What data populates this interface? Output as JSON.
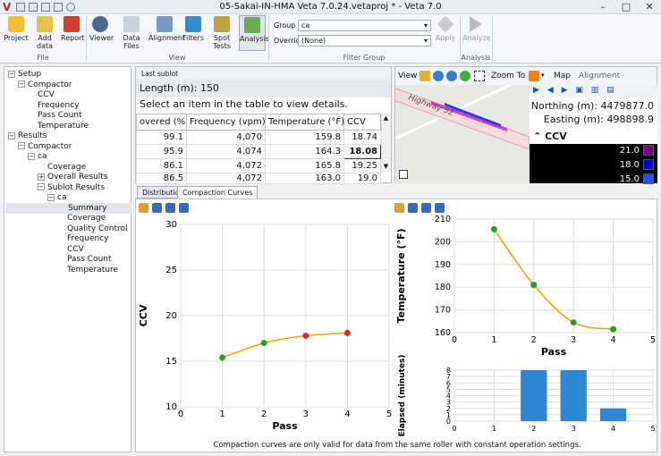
{
  "window": {
    "title": "05-Sakai-IN-HMA Veta 7.0.24.vetaproj * - Veta 7.0",
    "logo": "V"
  },
  "ribbon": {
    "file": [
      {
        "label": "Project"
      },
      {
        "label": "Add data"
      },
      {
        "label": "Report"
      }
    ],
    "file_group": "File",
    "view": [
      {
        "label": "Viewer"
      },
      {
        "label": "Data Files"
      },
      {
        "label": "Alignment"
      },
      {
        "label": "Filters"
      },
      {
        "label": "Spot Tests"
      },
      {
        "label": "Analysis"
      }
    ],
    "view_group": "View",
    "filter": {
      "group_label": "Group",
      "group_value": "ca",
      "override_label": "Override",
      "override_value": "(None)",
      "apply": "Apply"
    },
    "filter_group": "Filter Group",
    "analyze": "Analyze",
    "analysis_group": "Analysis"
  },
  "tree": [
    {
      "t": "Setup",
      "lvl": 0,
      "tg": "−"
    },
    {
      "t": "Compactor",
      "lvl": 1,
      "tg": "−"
    },
    {
      "t": "CCV",
      "lvl": 2
    },
    {
      "t": "Frequency",
      "lvl": 2
    },
    {
      "t": "Pass Count",
      "lvl": 2
    },
    {
      "t": "Temperature",
      "lvl": 2
    },
    {
      "t": "Results",
      "lvl": 0,
      "tg": "−"
    },
    {
      "t": "Compactor",
      "lvl": 1,
      "tg": "−"
    },
    {
      "t": "ca",
      "lvl": 2,
      "tg": "−"
    },
    {
      "t": "Coverage",
      "lvl": 3
    },
    {
      "t": "Overall Results",
      "lvl": 3,
      "tg": "+"
    },
    {
      "t": "Sublot Results",
      "lvl": 3,
      "tg": "−"
    },
    {
      "t": "ca",
      "lvl": 4,
      "tg": "−"
    },
    {
      "t": "Summary",
      "lvl": 5,
      "sel": true
    },
    {
      "t": "Coverage",
      "lvl": 5
    },
    {
      "t": "Quality Control",
      "lvl": 5
    },
    {
      "t": "Frequency",
      "lvl": 5
    },
    {
      "t": "CCV",
      "lvl": 5
    },
    {
      "t": "Pass Count",
      "lvl": 5
    },
    {
      "t": "Temperature",
      "lvl": 5
    }
  ],
  "sublot": {
    "header": "Last sublot",
    "length": "Length (m): 150",
    "message": "Select an item in the table to view details.",
    "columns": [
      "overed (%)",
      "Frequency (vpm)",
      "Temperature (°F)",
      "CCV"
    ],
    "rows": [
      [
        "99.1",
        "4,070",
        "159.8",
        "18.74"
      ],
      [
        "95.9",
        "4,074",
        "164.3",
        "18.08"
      ],
      [
        "86.1",
        "4,072",
        "165.8",
        "19.25"
      ],
      [
        "86.5",
        "4,072",
        "163.0",
        "19.0"
      ]
    ]
  },
  "map": {
    "view": "View",
    "zoom_to": "Zoom To",
    "map": "Map",
    "alignment": "Alignment",
    "road": "Highway 52",
    "northing": "Northing (m): 4479877.0",
    "easting": "Easting (m): 498898.9",
    "legend_title": "CCV",
    "legend": [
      {
        "v": "21.0",
        "c": "#800080"
      },
      {
        "v": "18.0",
        "c": "#0000e0"
      },
      {
        "v": "15.0",
        "c": "#2050ff"
      }
    ]
  },
  "tabs": [
    "Distribution",
    "Compaction Curves"
  ],
  "note": "Compaction curves are only valid for data from the same roller with constant operation settings.",
  "chart_data": [
    {
      "type": "line",
      "xlabel": "Pass",
      "ylabel": "CCV",
      "xlim": [
        0,
        5
      ],
      "ylim": [
        10,
        30
      ],
      "xticks": [
        "0",
        "1",
        "2",
        "3",
        "4",
        "5"
      ],
      "yticks": [
        "10",
        "15",
        "20",
        "25",
        "30"
      ],
      "x": [
        1,
        2,
        3,
        4
      ],
      "y": [
        15.4,
        17.0,
        17.8,
        18.1
      ],
      "colors": [
        "#2a9a2a",
        "#2a9a2a",
        "#e0281e",
        "#e0281e"
      ],
      "curve_color": "#f0a000"
    },
    {
      "type": "line",
      "xlabel": "Pass",
      "ylabel": "Temperature (°F)",
      "xlim": [
        0,
        5
      ],
      "ylim": [
        160,
        210
      ],
      "xticks": [
        "0",
        "1",
        "2",
        "3",
        "4",
        "5"
      ],
      "yticks": [
        "160",
        "170",
        "180",
        "190",
        "200",
        "210"
      ],
      "x": [
        1,
        2,
        3,
        4
      ],
      "y": [
        205.5,
        181,
        164.5,
        161.5
      ],
      "colors": [
        "#2a9a2a",
        "#2a9a2a",
        "#2a9a2a",
        "#2a9a2a"
      ],
      "curve_color": "#f0a000"
    },
    {
      "type": "bar",
      "xlabel": "",
      "ylabel": "Elapsed (minutes)",
      "xlim": [
        0,
        5
      ],
      "ylim": [
        0,
        8
      ],
      "xticks": [
        "0",
        "1",
        "2",
        "3",
        "4",
        "5"
      ],
      "yticks": [
        "0",
        "1",
        "2",
        "3",
        "4",
        "5",
        "6",
        "7",
        "8"
      ],
      "x": [
        2,
        3,
        4
      ],
      "values": [
        8,
        8,
        2
      ],
      "bar_color": "#2f86d2"
    }
  ]
}
